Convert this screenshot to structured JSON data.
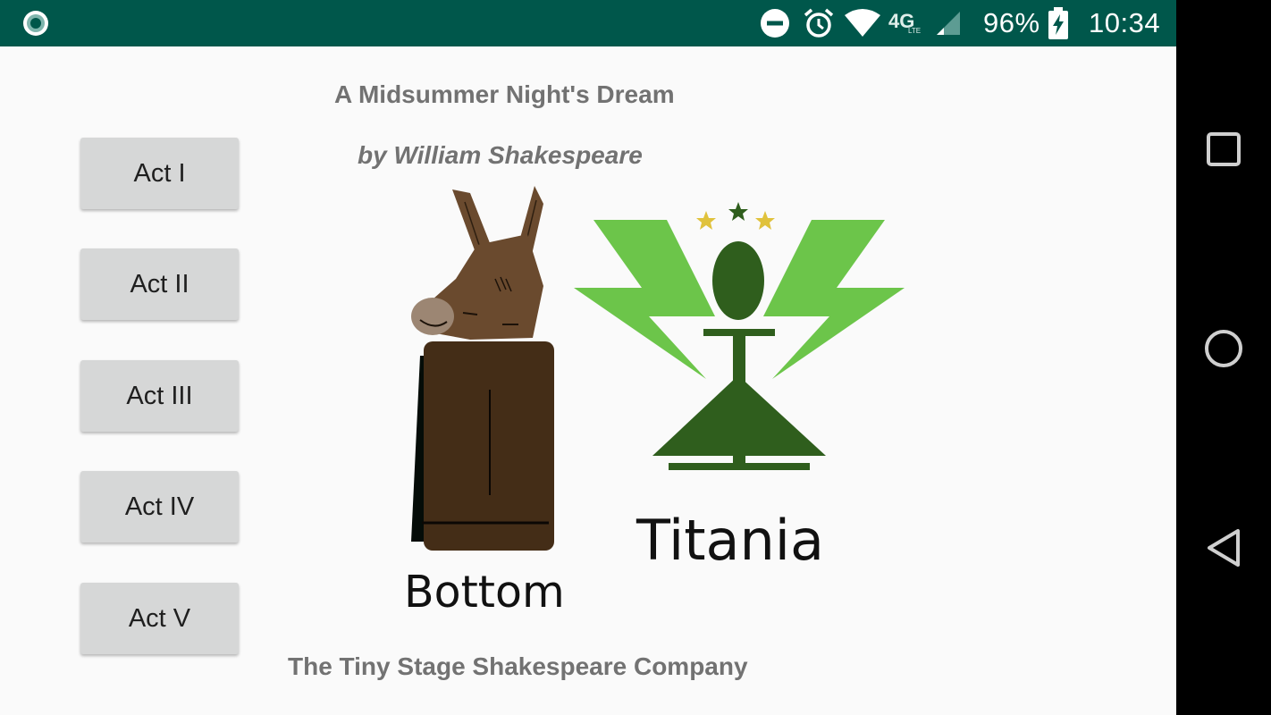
{
  "status_bar": {
    "battery_percent": "96%",
    "time": "10:34",
    "network": "4G",
    "network_sub": "LTE",
    "icons": [
      "app-notification-icon",
      "do-not-disturb-icon",
      "alarm-icon",
      "wifi-icon",
      "cell-signal-icon",
      "battery-charging-icon"
    ]
  },
  "app": {
    "title": "A Midsummer Night's Dream",
    "subtitle": "by William Shakespeare",
    "footer": "The Tiny Stage Shakespeare Company",
    "acts": [
      "Act I",
      "Act II",
      "Act III",
      "Act IV",
      "Act V"
    ],
    "characters": {
      "bottom_label": "Bottom",
      "titania_label": "Titania"
    }
  },
  "nav_bar": {
    "buttons": [
      "recents-icon",
      "home-icon",
      "back-icon"
    ]
  },
  "colors": {
    "status_bar": "#00574b",
    "button_bg": "#d6d7d7",
    "title_text": "#727272",
    "titania_light_green": "#6cc54a",
    "titania_dark_green": "#2f5e1d",
    "bottom_robe": "#442d17",
    "donkey_head": "#6a4a2e"
  }
}
